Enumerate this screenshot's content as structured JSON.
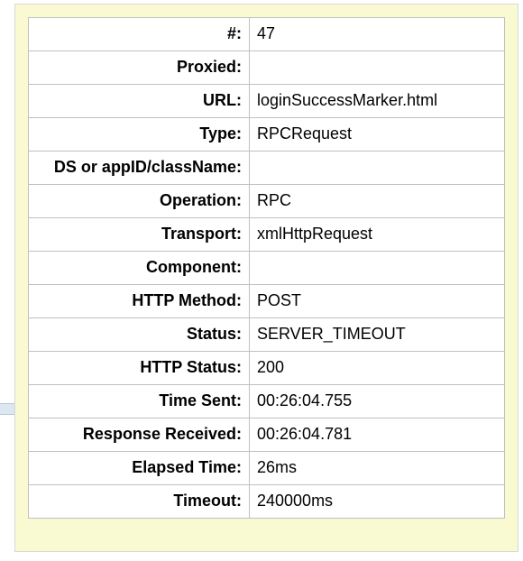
{
  "details": {
    "rows": [
      {
        "label": "#:",
        "value": "47"
      },
      {
        "label": "Proxied:",
        "value": ""
      },
      {
        "label": "URL:",
        "value": "loginSuccessMarker.html"
      },
      {
        "label": "Type:",
        "value": "RPCRequest"
      },
      {
        "label": "DS or appID/className:",
        "value": ""
      },
      {
        "label": "Operation:",
        "value": "RPC"
      },
      {
        "label": "Transport:",
        "value": "xmlHttpRequest"
      },
      {
        "label": "Component:",
        "value": ""
      },
      {
        "label": "HTTP Method:",
        "value": "POST"
      },
      {
        "label": "Status:",
        "value": "SERVER_TIMEOUT"
      },
      {
        "label": "HTTP Status:",
        "value": "200"
      },
      {
        "label": "Time Sent:",
        "value": "00:26:04.755"
      },
      {
        "label": "Response Received:",
        "value": "00:26:04.781"
      },
      {
        "label": "Elapsed Time:",
        "value": "26ms"
      },
      {
        "label": "Timeout:",
        "value": "240000ms"
      }
    ]
  }
}
